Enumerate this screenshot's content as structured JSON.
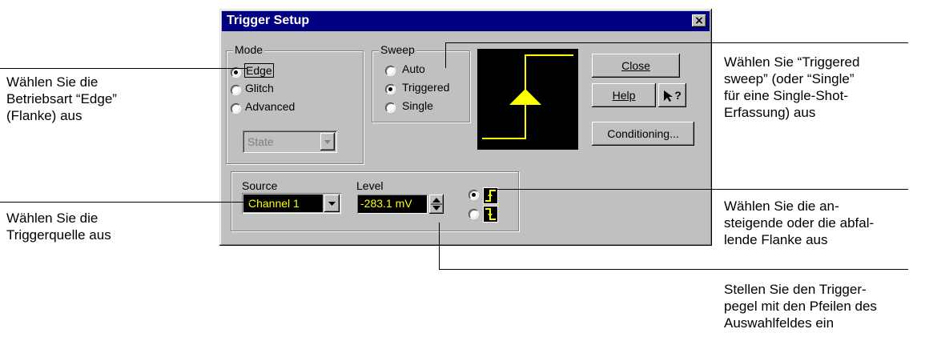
{
  "dialog": {
    "title": "Trigger Setup",
    "close_glyph": "×",
    "mode": {
      "label": "Mode",
      "options": [
        "Edge",
        "Glitch",
        "Advanced"
      ],
      "selected": "Edge",
      "state_select": "State"
    },
    "sweep": {
      "label": "Sweep",
      "options": [
        "Auto",
        "Triggered",
        "Single"
      ],
      "selected": "Triggered"
    },
    "buttons": {
      "close": "Close",
      "help": "Help",
      "whats_this": "?",
      "conditioning": "Conditioning..."
    },
    "source": {
      "label": "Source",
      "value": "Channel 1"
    },
    "level": {
      "label": "Level",
      "value": "-283.1 mV"
    },
    "slope": {
      "rising_selected": true
    },
    "colors": {
      "trace": "#ffff00",
      "display_bg": "#000000"
    }
  },
  "callouts": {
    "mode": "Wählen Sie die\nBetriebsart “Edge”\n(Flanke) aus",
    "source": "Wählen Sie die\nTriggerquelle aus",
    "sweep": "Wählen Sie “Triggered\nsweep” (oder “Single”\nfür eine Single-Shot-\nErfassung) aus",
    "slope": "Wählen Sie die an-\nsteigende oder die abfal-\nlende Flanke aus",
    "level": "Stellen Sie den Trigger-\npegel mit den Pfeilen des\nAuswahlfeldes ein"
  }
}
